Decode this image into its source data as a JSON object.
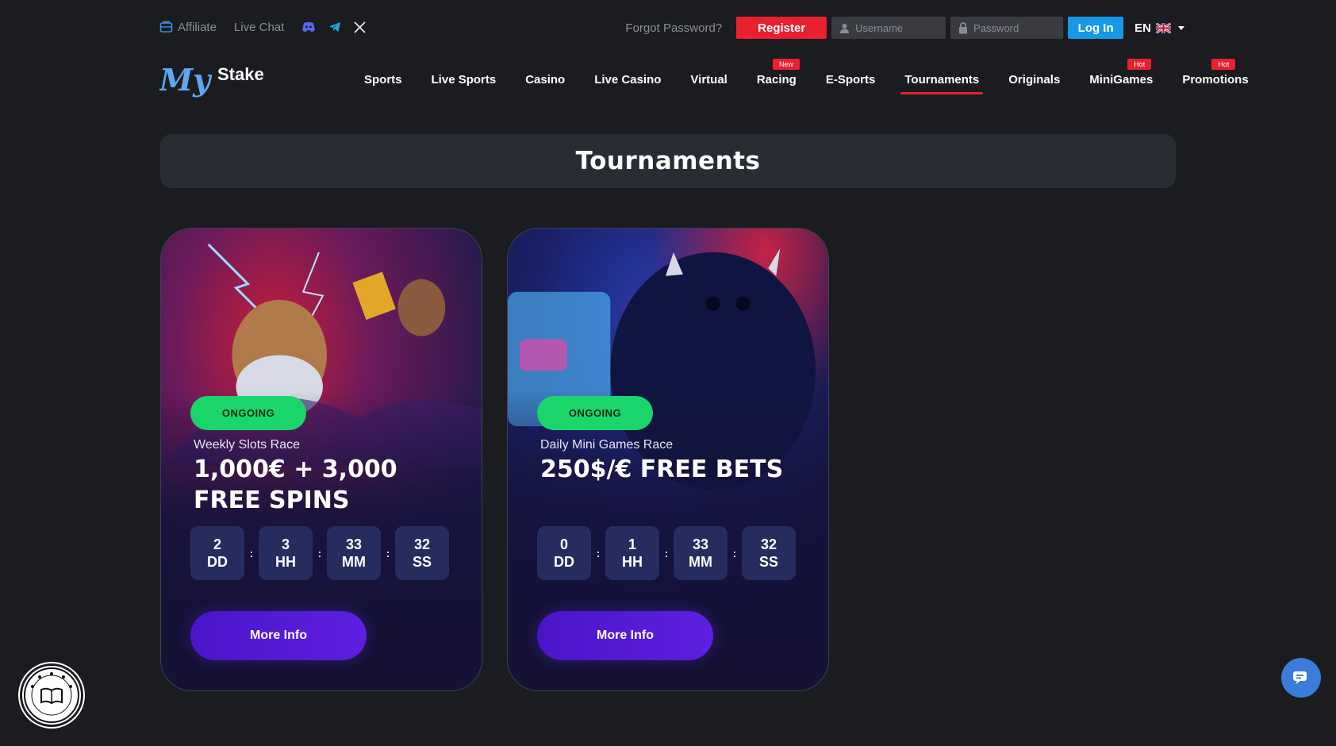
{
  "topbar": {
    "affiliate": "Affiliate",
    "live_chat": "Live Chat",
    "forgot_password": "Forgot Password?",
    "register": "Register",
    "username_placeholder": "Username",
    "password_placeholder": "Password",
    "login": "Log In",
    "language": "EN"
  },
  "logo": {
    "script": "My",
    "word": "Stake"
  },
  "nav": [
    {
      "label": "Sports"
    },
    {
      "label": "Live Sports"
    },
    {
      "label": "Casino"
    },
    {
      "label": "Live Casino"
    },
    {
      "label": "Virtual"
    },
    {
      "label": "Racing",
      "badge": "New"
    },
    {
      "label": "E-Sports"
    },
    {
      "label": "Tournaments",
      "active": true
    },
    {
      "label": "Originals"
    },
    {
      "label": "MiniGames",
      "badge": "Hot"
    },
    {
      "label": "Promotions",
      "badge": "Hot"
    }
  ],
  "page_title": "Tournaments",
  "cards": [
    {
      "status": "ONGOING",
      "subtitle": "Weekly Slots Race",
      "prize": "1,000€ + 3,000 FREE SPINS",
      "countdown": [
        {
          "value": "2",
          "unit": "DD"
        },
        {
          "value": "3",
          "unit": "HH"
        },
        {
          "value": "33",
          "unit": "MM"
        },
        {
          "value": "32",
          "unit": "SS"
        }
      ],
      "button": "More Info"
    },
    {
      "status": "ONGOING",
      "subtitle": "Daily Mini Games Race",
      "prize": "250$/€ FREE BETS",
      "countdown": [
        {
          "value": "0",
          "unit": "DD"
        },
        {
          "value": "1",
          "unit": "HH"
        },
        {
          "value": "33",
          "unit": "MM"
        },
        {
          "value": "32",
          "unit": "SS"
        }
      ],
      "button": "More Info"
    }
  ],
  "colors": {
    "background": "#1b1c20",
    "accent_red": "#e8202f",
    "login_blue": "#1598e6",
    "status_green": "#1ad66a",
    "button_purple": "#4a15c8"
  },
  "icons": [
    "affiliate-icon",
    "discord-icon",
    "telegram-icon",
    "x-icon",
    "user-icon",
    "lock-icon",
    "uk-flag-icon",
    "book-of-bonus-badge",
    "chat-icon"
  ]
}
